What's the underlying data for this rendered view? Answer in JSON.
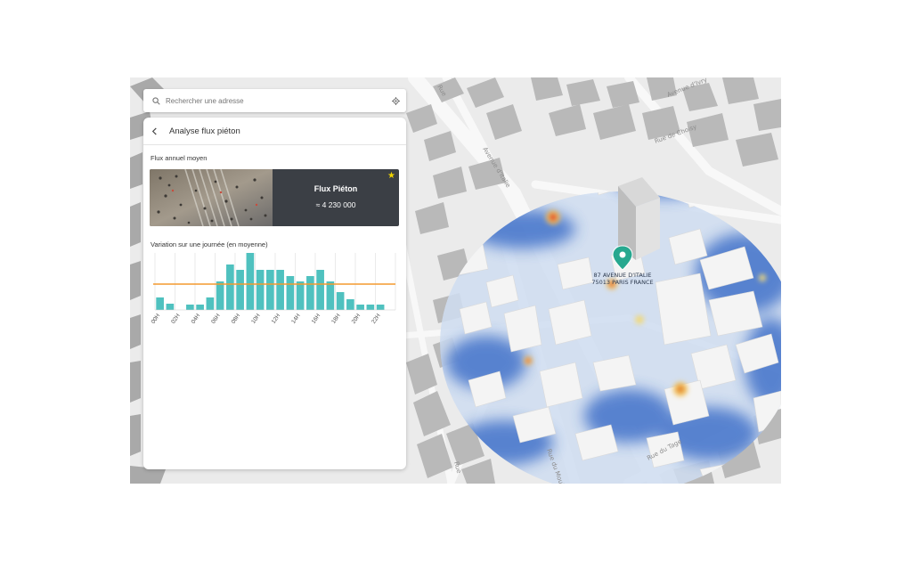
{
  "search": {
    "placeholder": "Rechercher une adresse"
  },
  "panel": {
    "title": "Analyse flux piéton",
    "section_annual": "Flux annuel moyen",
    "card": {
      "label": "Flux Piéton",
      "value": "≈ 4 230 000",
      "favorite": true
    },
    "section_daily": "Variation sur une journée (en moyenne)"
  },
  "chart_data": {
    "type": "bar",
    "x": [
      "00H",
      "01H",
      "02H",
      "03H",
      "04H",
      "05H",
      "06H",
      "07H",
      "08H",
      "09H",
      "10H",
      "11H",
      "12H",
      "13H",
      "14H",
      "15H",
      "16H",
      "17H",
      "18H",
      "19H",
      "20H",
      "21H",
      "22H",
      "23H"
    ],
    "values": [
      14,
      7,
      0,
      6,
      6,
      14,
      32,
      51,
      45,
      64,
      45,
      45,
      45,
      38,
      32,
      38,
      45,
      32,
      20,
      12,
      6,
      6,
      6,
      0
    ],
    "tick_labels": [
      "00H",
      "02H",
      "04H",
      "06H",
      "08H",
      "10H",
      "12H",
      "14H",
      "16H",
      "18H",
      "20H",
      "22H"
    ],
    "average_line": 29,
    "ylim": [
      0,
      64
    ],
    "grid": true,
    "colors": {
      "bars": "#4fc1bf",
      "average": "#f39a2f",
      "grid": "#dddddd"
    }
  },
  "map": {
    "marker_address": [
      "87 AVENUE D'ITALIE",
      "75013 PARIS FRANCE"
    ],
    "street_labels": [
      "Avenue d'Ivry",
      "Rue de Choisy",
      "Avenue d'Italie",
      "Rue du Tage",
      "Rue du Moulin",
      "Rue",
      "Rue"
    ],
    "colors": {
      "marker": "#27a88f",
      "heat_cool": "#2f63c4",
      "heat_hot": "#e0312a"
    }
  }
}
